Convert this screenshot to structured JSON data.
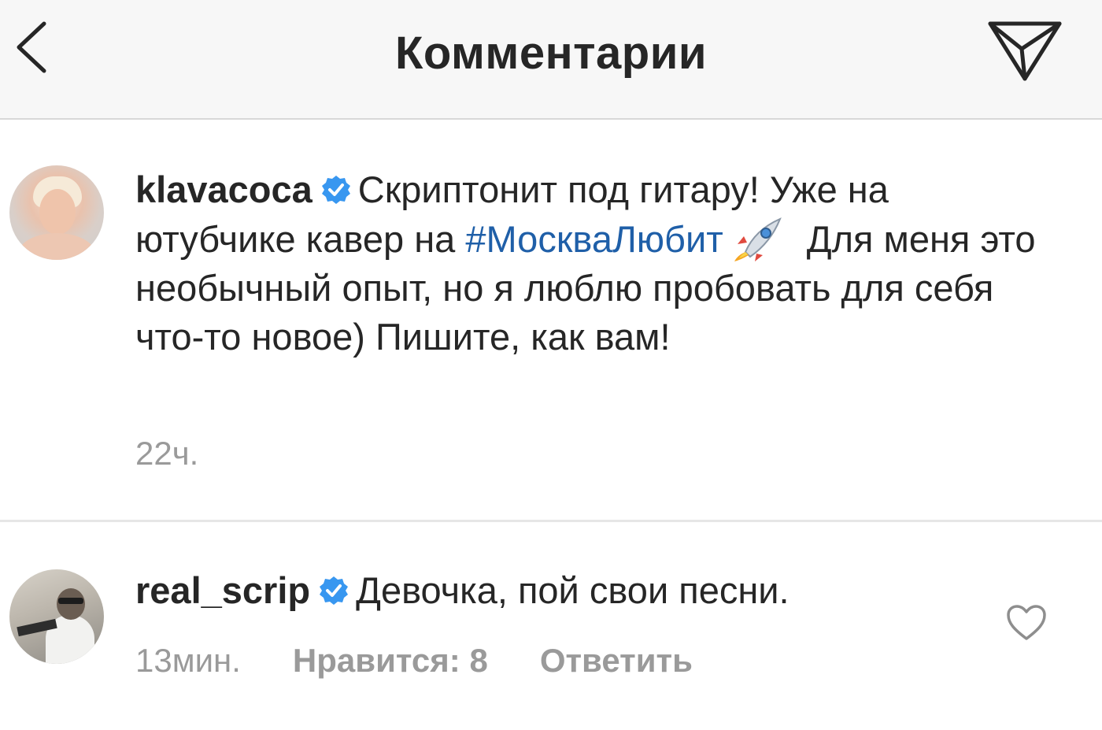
{
  "header": {
    "title": "Комментарии",
    "back_icon": "chevron-left-icon",
    "share_icon": "paper-plane-icon"
  },
  "caption": {
    "username": "klavacoca",
    "text_before_tag": "Скриптонит под гитару! Уже на ютубчике кавер на ",
    "hashtag": "#МоскваЛюбит",
    "emoji": "rocket-icon",
    "text_after_tag": "Для меня это необычный опыт, но я люблю пробовать для себя что-то новое) Пишите, как вам!",
    "time": "22ч."
  },
  "reply": {
    "username": "real_scrip",
    "text": "Девочка, пой свои песни.",
    "time": "13мин.",
    "likes_label": "Нравится: 8",
    "reply_label": "Ответить",
    "like_icon": "heart-outline-icon"
  },
  "colors": {
    "text": "#262626",
    "muted": "#9a9a9a",
    "hashtag": "#1f5fa8",
    "verified": "#3897f0",
    "header_bg": "#f7f7f7"
  }
}
